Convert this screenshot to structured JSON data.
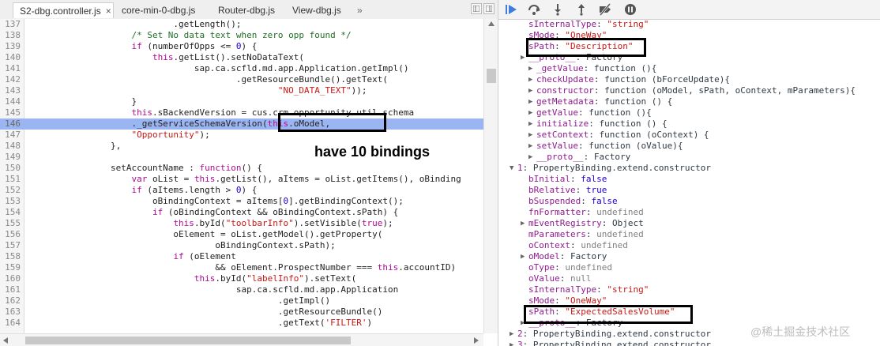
{
  "tabs": [
    {
      "label": "S2-dbg.controller.js",
      "active": true,
      "close": "×"
    },
    {
      "label": "core-min-0-dbg.js",
      "active": false
    },
    {
      "label": "Router-dbg.js",
      "active": false
    },
    {
      "label": "View-dbg.js",
      "active": false
    }
  ],
  "tabs_overflow": "»",
  "annotation_left": "have 10 bindings",
  "code_lines": [
    {
      "n": "137",
      "t": "                            .getLength();"
    },
    {
      "n": "138",
      "t": "                    /* Set No data text when zero opp found */"
    },
    {
      "n": "139",
      "t": "                    if (numberOfOpps <= 0) {"
    },
    {
      "n": "140",
      "t": "                        this.getList().setNoDataText("
    },
    {
      "n": "141",
      "t": "                                sap.ca.scfld.md.app.Application.getImpl()"
    },
    {
      "n": "142",
      "t": "                                        .getResourceBundle().getText("
    },
    {
      "n": "143",
      "t": "                                                \"NO_DATA_TEXT\"));"
    },
    {
      "n": "144",
      "t": "                    }"
    },
    {
      "n": "145",
      "t": "                    this.sBackendVersion = cus.crm.opportunity.util.schema"
    },
    {
      "n": "146",
      "t": "                    ._getServiceSchemaVersion(this.oModel,"
    },
    {
      "n": "147",
      "t": "                    \"Opportunity\");"
    },
    {
      "n": "148",
      "t": "                },"
    },
    {
      "n": "149",
      "t": ""
    },
    {
      "n": "150",
      "t": "                setAccountName : function() {"
    },
    {
      "n": "151",
      "t": "                    var oList = this.getList(), aItems = oList.getItems(), oBinding"
    },
    {
      "n": "152",
      "t": "                    if (aItems.length > 0) {"
    },
    {
      "n": "153",
      "t": "                        oBindingContext = aItems[0].getBindingContext();"
    },
    {
      "n": "154",
      "t": "                        if (oBindingContext && oBindingContext.sPath) {"
    },
    {
      "n": "155",
      "t": "                            this.byId(\"toolbarInfo\").setVisible(true);"
    },
    {
      "n": "156",
      "t": "                            oElement = oList.getModel().getProperty("
    },
    {
      "n": "157",
      "t": "                                    oBindingContext.sPath);"
    },
    {
      "n": "158",
      "t": "                            if (oElement"
    },
    {
      "n": "159",
      "t": "                                    && oElement.ProspectNumber === this.accountID)"
    },
    {
      "n": "160",
      "t": "                                this.byId(\"labelInfo\").setText("
    },
    {
      "n": "161",
      "t": "                                        sap.ca.scfld.md.app.Application"
    },
    {
      "n": "162",
      "t": "                                                .getImpl()"
    },
    {
      "n": "163",
      "t": "                                                .getResourceBundle()"
    },
    {
      "n": "164",
      "t": "                                                .getText('FILTER')"
    }
  ],
  "scope_rows": [
    {
      "indent": 0,
      "tri": "",
      "k": "sInternalType",
      "v": "\"string\"",
      "vt": "s"
    },
    {
      "indent": 0,
      "tri": "",
      "k": "sMode",
      "v": "\"OneWay\"",
      "vt": "s"
    },
    {
      "indent": 0,
      "tri": "",
      "k": "sPath",
      "v": "\"Description\"",
      "vt": "s"
    },
    {
      "indent": 0,
      "tri": "▶",
      "k": "__proto__",
      "v": "Factory",
      "vt": "cl"
    },
    {
      "indent": 1,
      "tri": "▶",
      "k": "_getValue",
      "v": "function (){",
      "vt": "cl"
    },
    {
      "indent": 1,
      "tri": "▶",
      "k": "checkUpdate",
      "v": "function (bForceUpdate){",
      "vt": "cl"
    },
    {
      "indent": 1,
      "tri": "▶",
      "k": "constructor",
      "v": "function (oModel, sPath, oContext, mParameters){",
      "vt": "cl"
    },
    {
      "indent": 1,
      "tri": "▶",
      "k": "getMetadata",
      "v": "function () {",
      "vt": "cl"
    },
    {
      "indent": 1,
      "tri": "▶",
      "k": "getValue",
      "v": "function (){",
      "vt": "cl"
    },
    {
      "indent": 1,
      "tri": "▶",
      "k": "initialize",
      "v": "function () {",
      "vt": "cl"
    },
    {
      "indent": 1,
      "tri": "▶",
      "k": "setContext",
      "v": "function (oContext) {",
      "vt": "cl"
    },
    {
      "indent": 1,
      "tri": "▶",
      "k": "setValue",
      "v": "function (oValue){",
      "vt": "cl"
    },
    {
      "indent": 1,
      "tri": "▶",
      "k": "__proto__",
      "v": "Factory",
      "vt": "cl"
    },
    {
      "indent": -1,
      "tri": "▼",
      "k": "1",
      "v": "PropertyBinding.extend.constructor",
      "vt": "cl"
    },
    {
      "indent": 0,
      "tri": "",
      "k": "bInitial",
      "v": "false",
      "vt": "n"
    },
    {
      "indent": 0,
      "tri": "",
      "k": "bRelative",
      "v": "true",
      "vt": "n"
    },
    {
      "indent": 0,
      "tri": "",
      "k": "bSuspended",
      "v": "false",
      "vt": "n"
    },
    {
      "indent": 0,
      "tri": "",
      "k": "fnFormatter",
      "v": "undefined",
      "vt": "g"
    },
    {
      "indent": 0,
      "tri": "▶",
      "k": "mEventRegistry",
      "v": "Object",
      "vt": "cl"
    },
    {
      "indent": 0,
      "tri": "",
      "k": "mParameters",
      "v": "undefined",
      "vt": "g"
    },
    {
      "indent": 0,
      "tri": "",
      "k": "oContext",
      "v": "undefined",
      "vt": "g"
    },
    {
      "indent": 0,
      "tri": "▶",
      "k": "oModel",
      "v": "Factory",
      "vt": "cl"
    },
    {
      "indent": 0,
      "tri": "",
      "k": "oType",
      "v": "undefined",
      "vt": "g"
    },
    {
      "indent": 0,
      "tri": "",
      "k": "oValue",
      "v": "null",
      "vt": "g"
    },
    {
      "indent": 0,
      "tri": "",
      "k": "sInternalType",
      "v": "\"string\"",
      "vt": "s"
    },
    {
      "indent": 0,
      "tri": "",
      "k": "sMode",
      "v": "\"OneWay\"",
      "vt": "s"
    },
    {
      "indent": 0,
      "tri": "",
      "k": "sPath",
      "v": "\"ExpectedSalesVolume\"",
      "vt": "s"
    },
    {
      "indent": 0,
      "tri": "▶",
      "k": "__proto__",
      "v": "Factory",
      "vt": "cl"
    },
    {
      "indent": -1,
      "tri": "▶",
      "k": "2",
      "v": "PropertyBinding.extend.constructor",
      "vt": "cl"
    },
    {
      "indent": -1,
      "tri": "▶",
      "k": "3",
      "v": "PropertyBinding.extend.constructor",
      "vt": "cl"
    }
  ],
  "watermark": "@稀土掘金技术社区",
  "toolbar_icons": [
    "resume-icon",
    "step-over-icon",
    "step-into-icon",
    "step-out-icon",
    "deactivate-breakpoints-icon",
    "pause-on-exceptions-icon"
  ]
}
